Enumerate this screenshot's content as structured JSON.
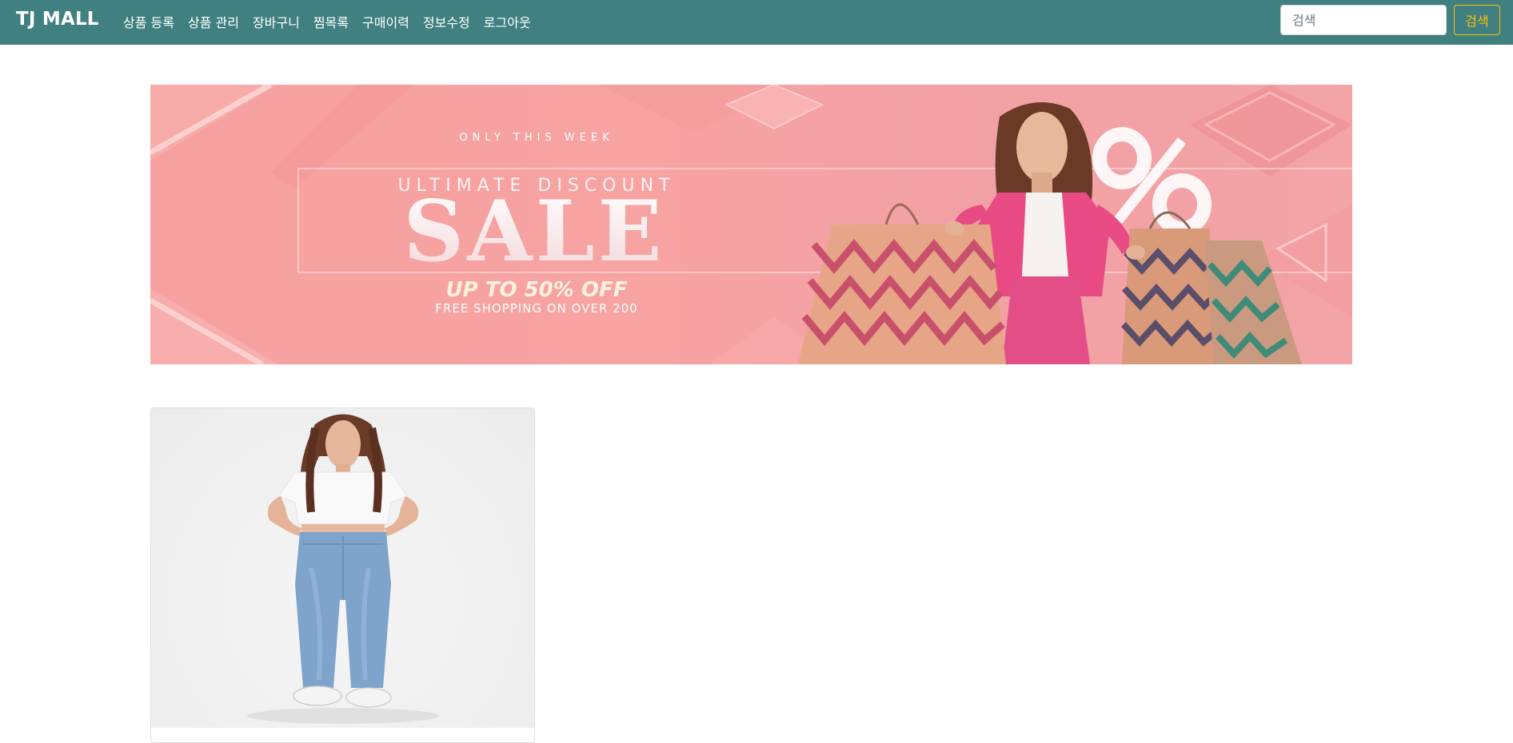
{
  "navbar": {
    "brand": "TJ MALL",
    "links": [
      "상품 등록",
      "상품 관리",
      "장바구니",
      "찜목록",
      "구매이력",
      "정보수정",
      "로그아웃"
    ],
    "search": {
      "placeholder": "검색",
      "button_label": "검색"
    },
    "background_color": "#408080",
    "accent_color": "#ffc107"
  },
  "banner": {
    "eyebrow": "ONLY THIS WEEK",
    "subtitle": "ULTIMATE DISCOUNT",
    "headline": "SALE",
    "offer": "UP TO 50% OFF",
    "shipping": "FREE SHOPPING ON OVER 200",
    "background_color": "#f6a1a0"
  },
  "products": [
    {
      "image_alt": "woman in white crop top and blue jeans"
    }
  ]
}
